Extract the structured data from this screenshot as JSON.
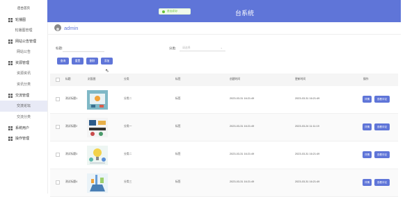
{
  "sidebar": {
    "home": "后台首页",
    "groups": [
      {
        "label": "轮播图",
        "icon": "carousel-icon",
        "subs": [
          "轮播图管理"
        ]
      },
      {
        "label": "网站公告管理",
        "icon": "notice-icon",
        "subs": [
          "网站公告"
        ]
      },
      {
        "label": "资源管理",
        "icon": "resource-icon",
        "subs": [
          "资源资讯",
          "资讯分类"
        ]
      },
      {
        "label": "交流管理",
        "icon": "exchange-icon",
        "subs": [
          "交流论坛",
          "交流分类"
        ]
      },
      {
        "label": "系统用户",
        "icon": "user-icon",
        "subs": []
      },
      {
        "label": "操作管理",
        "icon": "operation-icon",
        "subs": []
      }
    ]
  },
  "header": {
    "title": "台系统",
    "accent": "#5f75d8"
  },
  "toast": {
    "text": "退出成功!"
  },
  "user": {
    "name": "admin"
  },
  "filters": {
    "title_label": "标题:",
    "category_label": "分类:",
    "category_placeholder": "请选择"
  },
  "buttons": {
    "search": "查询",
    "reset": "重置",
    "delete": "删除",
    "add": "添加"
  },
  "table": {
    "headers": {
      "title": "标题",
      "thumb": "封面图",
      "category": "分类",
      "tag": "标签",
      "created": "创建时间",
      "updated": "更新时间",
      "actions": "操作"
    },
    "rows": [
      {
        "title": "测试标题1",
        "category": "分类二",
        "tag": "标签",
        "created": "2023-03-31 16:21:49",
        "updated": "2023-03-31 16:21:49",
        "detail": "详情",
        "comment": "查看评论"
      },
      {
        "title": "测试标题2",
        "category": "分类一",
        "tag": "标签",
        "created": "2023-03-31 16:21:49",
        "updated": "2023-03-24 11:11:19",
        "detail": "详情",
        "comment": "查看评论"
      },
      {
        "title": "测试标题3",
        "category": "分类二",
        "tag": "标签",
        "created": "2023-03-31 16:21:49",
        "updated": "2023-03-31 16:21:49",
        "detail": "详情",
        "comment": "查看评论"
      },
      {
        "title": "测试标题4",
        "category": "分类三",
        "tag": "标签",
        "created": "2023-03-31 16:21:49",
        "updated": "2023-03-31 16:21:49",
        "detail": "详情",
        "comment": "查看评论"
      }
    ]
  }
}
